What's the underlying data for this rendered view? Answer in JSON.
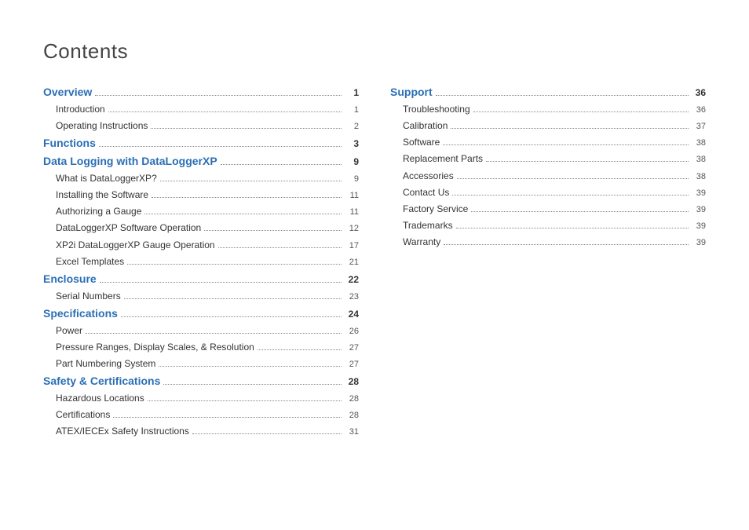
{
  "title": "Contents",
  "colors": {
    "link": "#2a6fb5",
    "text": "#333"
  },
  "left_column": [
    {
      "type": "section",
      "label": "Overview",
      "page": "1"
    },
    {
      "type": "sub",
      "label": "Introduction",
      "page": "1"
    },
    {
      "type": "sub",
      "label": "Operating Instructions",
      "page": "2"
    },
    {
      "type": "section",
      "label": "Functions",
      "page": "3"
    },
    {
      "type": "section",
      "label": "Data Logging with DataLoggerXP",
      "page": "9"
    },
    {
      "type": "sub",
      "label": "What is DataLoggerXP?",
      "page": "9"
    },
    {
      "type": "sub",
      "label": "Installing the Software",
      "page": "11"
    },
    {
      "type": "sub",
      "label": "Authorizing a Gauge",
      "page": "11"
    },
    {
      "type": "sub",
      "label": "DataLoggerXP Software Operation",
      "page": "12"
    },
    {
      "type": "sub",
      "label": "XP2i DataLoggerXP Gauge Operation",
      "page": "17"
    },
    {
      "type": "sub",
      "label": "Excel Templates",
      "page": "21"
    },
    {
      "type": "section",
      "label": "Enclosure",
      "page": "22"
    },
    {
      "type": "sub",
      "label": "Serial Numbers",
      "page": "23"
    },
    {
      "type": "section",
      "label": "Specifications",
      "page": "24"
    },
    {
      "type": "sub",
      "label": "Power",
      "page": "26"
    },
    {
      "type": "sub",
      "label": "Pressure Ranges, Display Scales, & Resolution",
      "page": "27"
    },
    {
      "type": "sub",
      "label": "Part Numbering System",
      "page": "27"
    },
    {
      "type": "section",
      "label": "Safety & Certifications",
      "page": "28"
    },
    {
      "type": "sub",
      "label": "Hazardous Locations",
      "page": "28"
    },
    {
      "type": "sub",
      "label": "Certifications",
      "page": "28"
    },
    {
      "type": "sub",
      "label": "ATEX/IECEx Safety Instructions",
      "page": "31"
    }
  ],
  "right_column": [
    {
      "type": "section",
      "label": "Support",
      "page": "36"
    },
    {
      "type": "sub",
      "label": "Troubleshooting",
      "page": "36"
    },
    {
      "type": "sub",
      "label": "Calibration",
      "page": "37"
    },
    {
      "type": "sub",
      "label": "Software",
      "page": "38"
    },
    {
      "type": "sub",
      "label": "Replacement Parts",
      "page": "38"
    },
    {
      "type": "sub",
      "label": "Accessories",
      "page": "38"
    },
    {
      "type": "sub",
      "label": "Contact Us",
      "page": "39"
    },
    {
      "type": "sub",
      "label": "Factory Service",
      "page": "39"
    },
    {
      "type": "sub",
      "label": "Trademarks",
      "page": "39"
    },
    {
      "type": "sub",
      "label": "Warranty",
      "page": "39"
    }
  ]
}
